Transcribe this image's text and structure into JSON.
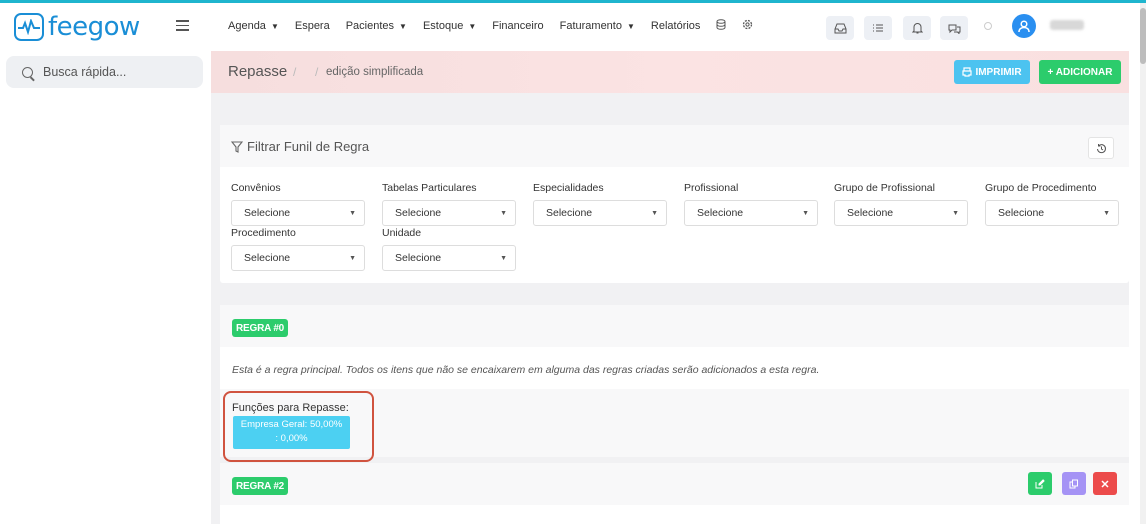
{
  "app": {
    "name": "feegow"
  },
  "topnav": {
    "items": [
      {
        "label": "Agenda",
        "dropdown": true
      },
      {
        "label": "Espera",
        "dropdown": false
      },
      {
        "label": "Pacientes",
        "dropdown": true
      },
      {
        "label": "Estoque",
        "dropdown": true
      },
      {
        "label": "Financeiro",
        "dropdown": false
      },
      {
        "label": "Faturamento",
        "dropdown": true
      },
      {
        "label": "Relatórios",
        "dropdown": false
      }
    ],
    "icons": [
      "database-icon",
      "settings-icon",
      "inbox-icon",
      "checklist-icon",
      "bell-icon",
      "chat-icon"
    ]
  },
  "sidebar": {
    "search_placeholder": "Busca rápida..."
  },
  "page": {
    "title": "Repasse",
    "breadcrumb_sep": "/",
    "breadcrumb": "edição simplificada",
    "print_label": "IMPRIMIR",
    "add_label": "+ ADICIONAR"
  },
  "filter": {
    "title": "Filtrar Funil de Regra",
    "fields": [
      {
        "label": "Convênios",
        "value": "Selecione"
      },
      {
        "label": "Tabelas Particulares",
        "value": "Selecione"
      },
      {
        "label": "Especialidades",
        "value": "Selecione"
      },
      {
        "label": "Profissional",
        "value": "Selecione"
      },
      {
        "label": "Grupo de Profissional",
        "value": "Selecione"
      },
      {
        "label": "Grupo de Procedimento",
        "value": "Selecione"
      },
      {
        "label": "Procedimento",
        "value": "Selecione"
      },
      {
        "label": "Unidade",
        "value": "Selecione"
      }
    ]
  },
  "regras": [
    {
      "badge": "REGRA #0",
      "description": "Esta é a regra principal. Todos os itens que não se encaixarem em alguma das regras criadas serão adicionados a esta regra.",
      "funcoes_label": "Funções para Repasse:",
      "funcao_line1": "Empresa Geral: 50,00%",
      "funcao_line2": ": 0,00%"
    },
    {
      "badge": "REGRA #2"
    }
  ],
  "colors": {
    "accent": "#1fb5ce",
    "brand": "#1a8ed6",
    "success": "#2ccc6c",
    "info": "#4cc3f0",
    "danger": "#ec4b4b",
    "purple": "#a593f5",
    "highlight": "#d0533f"
  }
}
